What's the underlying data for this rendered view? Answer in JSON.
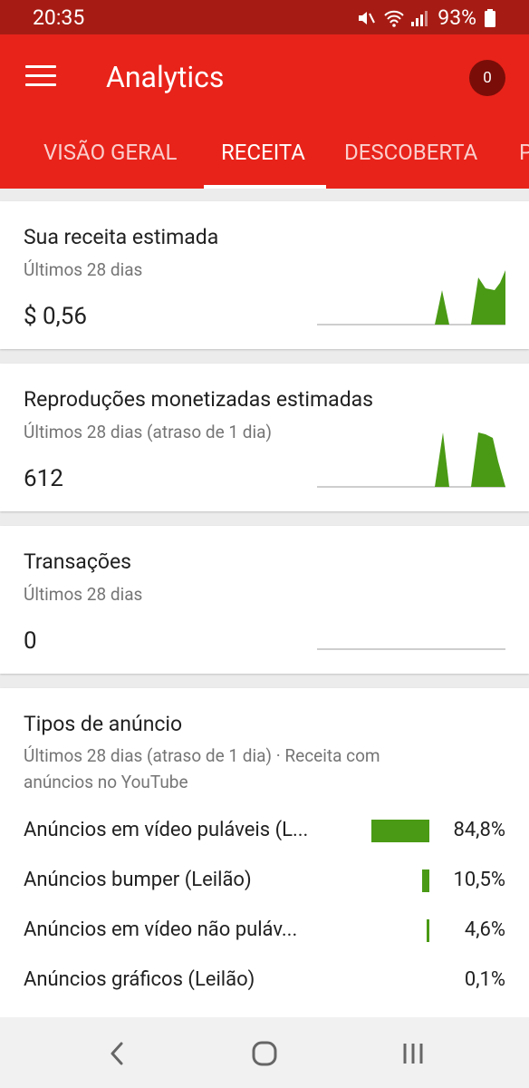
{
  "status_bar": {
    "time": "20:35",
    "battery": "93%",
    "icons": [
      "mute-icon",
      "wifi-icon",
      "signal-icon",
      "battery-icon"
    ]
  },
  "app_bar": {
    "title": "Analytics",
    "notifications": "0"
  },
  "tabs": [
    {
      "label": "VISÃO GERAL",
      "active": false
    },
    {
      "label": "RECEITA",
      "active": true
    },
    {
      "label": "DESCOBERTA",
      "active": false
    },
    {
      "label": "P",
      "active": false
    }
  ],
  "cards": {
    "revenue": {
      "title": "Sua receita estimada",
      "period": "Últimos 28 dias",
      "value": "$ 0,56"
    },
    "playbacks": {
      "title": "Reproduções monetizadas estimadas",
      "period": "Últimos 28 dias (atraso de 1 dia)",
      "value": "612"
    },
    "transactions": {
      "title": "Transações",
      "period": "Últimos 28 dias",
      "value": "0"
    },
    "ad_types": {
      "title": "Tipos de anúncio",
      "period_line1": "Últimos 28 dias (atraso de 1 dia) · Receita com",
      "period_line2": "anúncios no YouTube",
      "rows": [
        {
          "label": "Anúncios em vídeo puláveis (L...",
          "percent": "84,8%",
          "share": 0.848
        },
        {
          "label": "Anúncios bumper (Leilão)",
          "percent": "10,5%",
          "share": 0.105
        },
        {
          "label": "Anúncios em vídeo não puláv...",
          "percent": "4,6%",
          "share": 0.046
        },
        {
          "label": "Anúncios gráficos (Leilão)",
          "percent": "0,1%",
          "share": 0.001
        }
      ]
    }
  },
  "colors": {
    "app_bar": "#e8231a",
    "status_bar": "#a61c14",
    "chart_green": "#4a9a15",
    "badge": "#7a0d08"
  },
  "nav_bar": {
    "icons": [
      "back-icon",
      "home-icon",
      "recents-icon"
    ]
  }
}
